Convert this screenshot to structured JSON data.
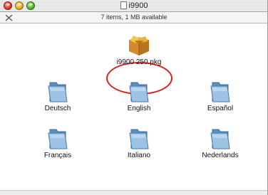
{
  "window": {
    "title": "i9900",
    "status": "7 items, 1 MB available"
  },
  "package": {
    "label": "i9900 250.pkg",
    "highlight_color": "#d82020",
    "icon": "package-box-icon"
  },
  "folders": [
    {
      "label": "Deutsch"
    },
    {
      "label": "English"
    },
    {
      "label": "Español"
    },
    {
      "label": "Français"
    },
    {
      "label": "Italiano"
    },
    {
      "label": "Nederlands"
    }
  ],
  "icons": {
    "folder": "folder-icon",
    "toolbar_toggle": "pencil-icon",
    "document": "document-icon"
  }
}
